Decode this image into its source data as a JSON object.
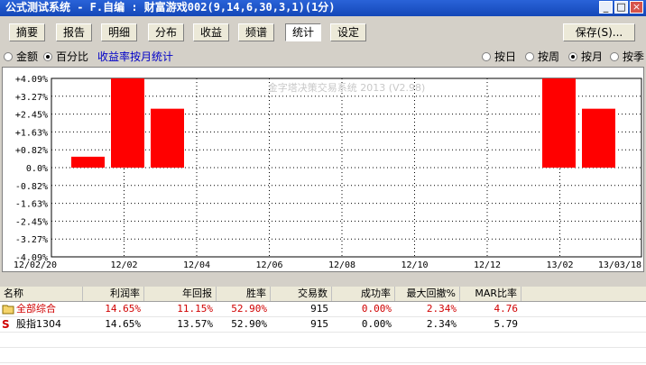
{
  "window": {
    "title": "公式测试系统 - F.自编 : 财富游戏002(9,14,6,30,3,1)(1分)",
    "min": "_",
    "max": "□",
    "close": "×"
  },
  "tabs": [
    "摘要",
    "报告",
    "明细",
    "分布",
    "收益",
    "频谱",
    "统计",
    "设定"
  ],
  "active_tab": "统计",
  "save_label": "保存(S)...",
  "options": {
    "amount": "金额",
    "percent": "百分比",
    "link": "收益率按月统计",
    "by_day": "按日",
    "by_week": "按周",
    "by_month": "按月",
    "by_quarter": "按季"
  },
  "colors": {
    "bar": "#ff0000",
    "grid": "#000000",
    "accent_red": "#d00000"
  },
  "chart_data": {
    "type": "bar",
    "watermark": "金字塔决策交易系统 2013 (V2.98)",
    "yticks": [
      "+4.09%",
      "+3.27%",
      "+2.45%",
      "+1.63%",
      "+0.82%",
      "0.0%",
      "-0.82%",
      "-1.63%",
      "-2.45%",
      "-3.27%",
      "-4.09%"
    ],
    "ylim": [
      -4.09,
      4.09
    ],
    "xticks": [
      "12/02/20",
      "12/02",
      "12/04",
      "12/06",
      "12/08",
      "12/10",
      "12/12",
      "13/02",
      "13/03/18"
    ],
    "categories": [
      "2012-02",
      "2012-03",
      "2012-04",
      "2013-02",
      "2013-03"
    ],
    "values": [
      0.5,
      4.09,
      2.7,
      4.09,
      2.7
    ]
  },
  "table": {
    "headers": [
      "名称",
      "利润率",
      "年回报",
      "胜率",
      "交易数",
      "成功率",
      "最大回撤%",
      "MAR比率"
    ],
    "rows": [
      {
        "icon": "folder-icon",
        "name": "全部综合",
        "cells": [
          "14.65%",
          "11.15%",
          "52.90%",
          "915",
          "0.00%",
          "2.34%",
          "4.76"
        ]
      },
      {
        "icon": "s-icon",
        "name": "股指1304",
        "cells": [
          "14.65%",
          "13.57%",
          "52.90%",
          "915",
          "0.00%",
          "2.34%",
          "5.79"
        ]
      }
    ]
  }
}
